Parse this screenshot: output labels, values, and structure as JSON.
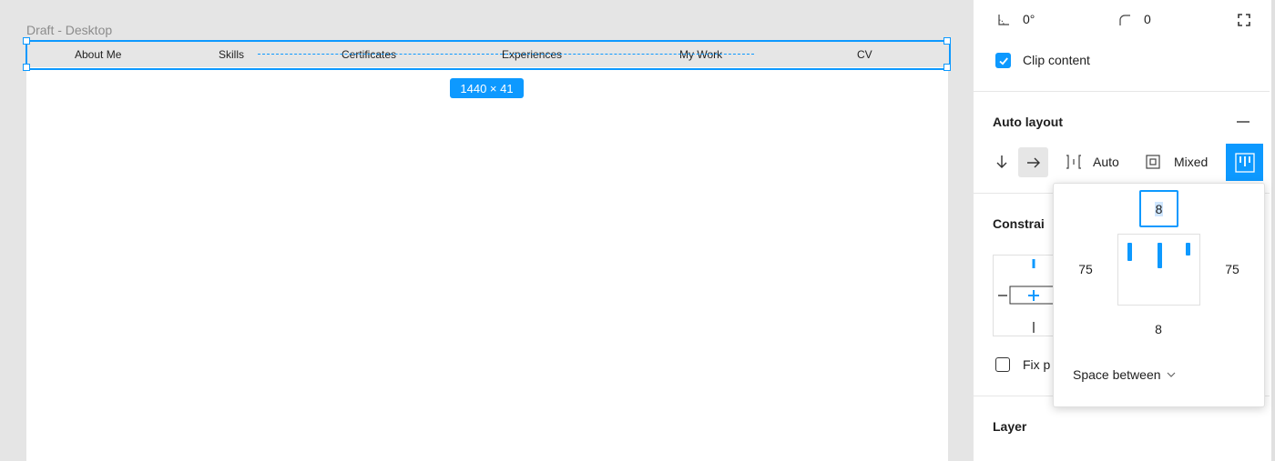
{
  "canvas": {
    "frame_label": "Draft - Desktop",
    "nav_items": [
      "About Me",
      "Skills",
      "Certificates",
      "Experiences",
      "My Work",
      "CV"
    ],
    "size_badge": "1440 × 41"
  },
  "panel": {
    "rotation": "0°",
    "corner_radius": "0",
    "clip_content_label": "Clip content",
    "clip_content_checked": true,
    "auto_layout": {
      "title": "Auto layout",
      "spacing_value": "Auto",
      "padding_value": "Mixed"
    },
    "constraints_title": "Constrai",
    "fix_position_label": "Fix p",
    "layer_title": "Layer"
  },
  "padding_popover": {
    "top": "8",
    "left": "75",
    "right": "75",
    "bottom": "8",
    "distribution": "Space between"
  },
  "colors": {
    "accent": "#0d99ff",
    "canvas_bg": "#e5e5e5",
    "navbar_bg": "#e6e6e6"
  },
  "icons": {
    "rotation": "angle-icon",
    "radius": "corner-radius-icon",
    "independent_corners": "expand-corners-icon",
    "checkbox": "checkmark-icon",
    "remove_auto_layout": "minus-icon",
    "direction_vertical": "arrow-down-icon",
    "direction_horizontal": "arrow-right-icon",
    "spacing": "spacing-between-icon",
    "padding": "padding-icon",
    "alignment": "alignment-icon",
    "dropdown": "chevron-down-icon"
  }
}
